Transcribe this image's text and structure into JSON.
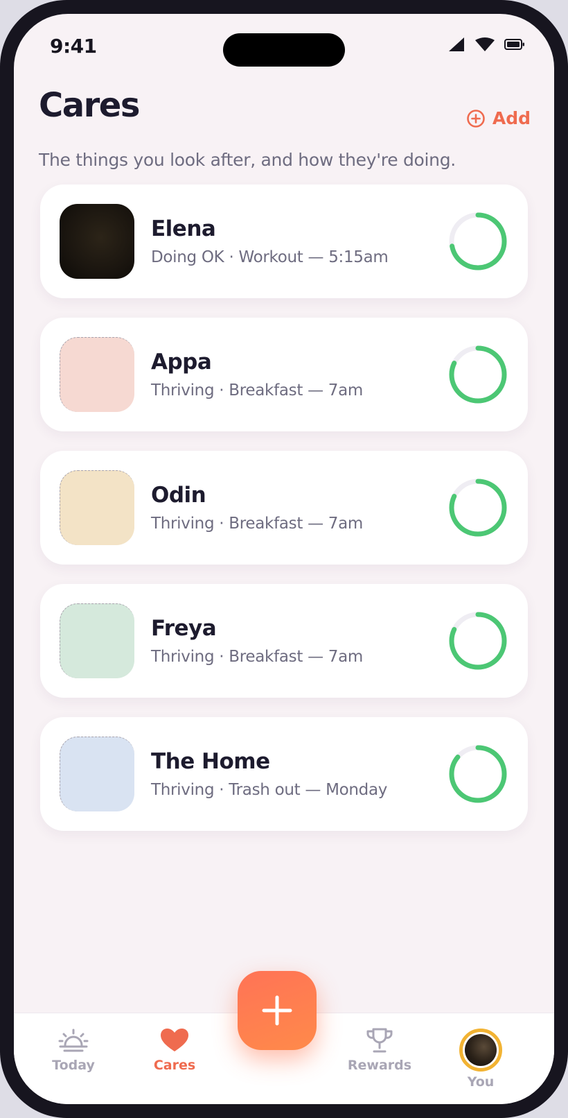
{
  "status_bar": {
    "time": "9:41"
  },
  "header": {
    "title": "Cares",
    "add_label": "Add",
    "subtitle": "The things you look after, and how they're doing."
  },
  "cares": [
    {
      "name": "Elena",
      "status": "Doing OK · Workout — 5:15am",
      "progress": 0.72,
      "thumb_color": "#1a150f",
      "photo": true
    },
    {
      "name": "Appa",
      "status": "Thriving · Breakfast — 7am",
      "progress": 0.82,
      "thumb_color": "#f6d9d2",
      "photo": false
    },
    {
      "name": "Odin",
      "status": "Thriving · Breakfast — 7am",
      "progress": 0.82,
      "thumb_color": "#f3e3c6",
      "photo": false
    },
    {
      "name": "Freya",
      "status": "Thriving · Breakfast — 7am",
      "progress": 0.82,
      "thumb_color": "#d5e9dc",
      "photo": false
    },
    {
      "name": "The Home",
      "status": "Thriving · Trash out — Monday",
      "progress": 0.86,
      "thumb_color": "#d9e3f2",
      "photo": false
    }
  ],
  "tabs": [
    {
      "label": "Today",
      "icon": "sunrise-icon",
      "active": false
    },
    {
      "label": "Cares",
      "icon": "heart-icon",
      "active": true
    },
    {
      "label": "Rewards",
      "icon": "trophy-icon",
      "active": false
    },
    {
      "label": "You",
      "icon": "avatar",
      "active": false
    }
  ],
  "colors": {
    "accent": "#ef6b4f",
    "ring": "#4cc774",
    "title": "#1d1b2e",
    "muted": "#6e6c80"
  }
}
